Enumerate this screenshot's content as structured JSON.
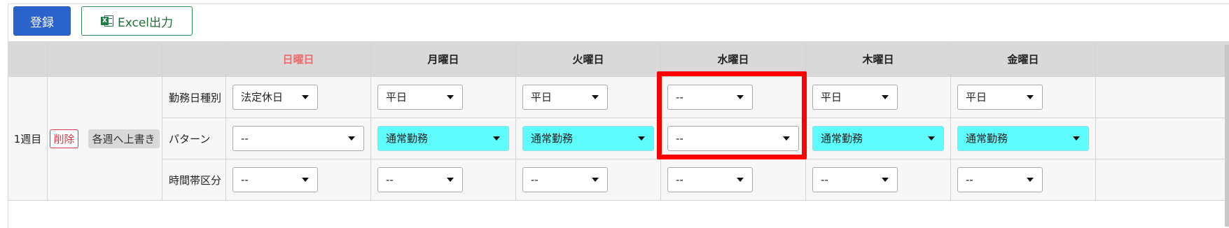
{
  "toolbar": {
    "register_label": "登録",
    "excel_label": "Excel出力",
    "excel_icon": "excel-file-icon"
  },
  "table": {
    "days": [
      {
        "label": "日曜日",
        "color": "#f06a6a"
      },
      {
        "label": "月曜日",
        "color": "#222222"
      },
      {
        "label": "火曜日",
        "color": "#222222"
      },
      {
        "label": "水曜日",
        "color": "#222222"
      },
      {
        "label": "木曜日",
        "color": "#222222"
      },
      {
        "label": "金曜日",
        "color": "#222222"
      }
    ],
    "week_label": "1週目",
    "delete_label": "削除",
    "overwrite_label": "各週へ上書き",
    "rows": [
      {
        "label": "勤務日種別",
        "values": [
          "法定休日",
          "平日",
          "平日",
          "--",
          "平日",
          "平日"
        ]
      },
      {
        "label": "パターン",
        "values": [
          "--",
          "通常勤務",
          "通常勤務",
          "--",
          "通常勤務",
          "通常勤務"
        ],
        "highlighted": [
          false,
          true,
          true,
          false,
          true,
          true
        ]
      },
      {
        "label": "時間帯区分",
        "values": [
          "--",
          "--",
          "--",
          "--",
          "--",
          "--"
        ]
      }
    ]
  },
  "colors": {
    "primary_button": "#2a63cc",
    "excel_green": "#1f6f3a",
    "pattern_fill": "#5efcfc",
    "highlight_box": "#ff0000",
    "delete_red": "#dc3545"
  }
}
